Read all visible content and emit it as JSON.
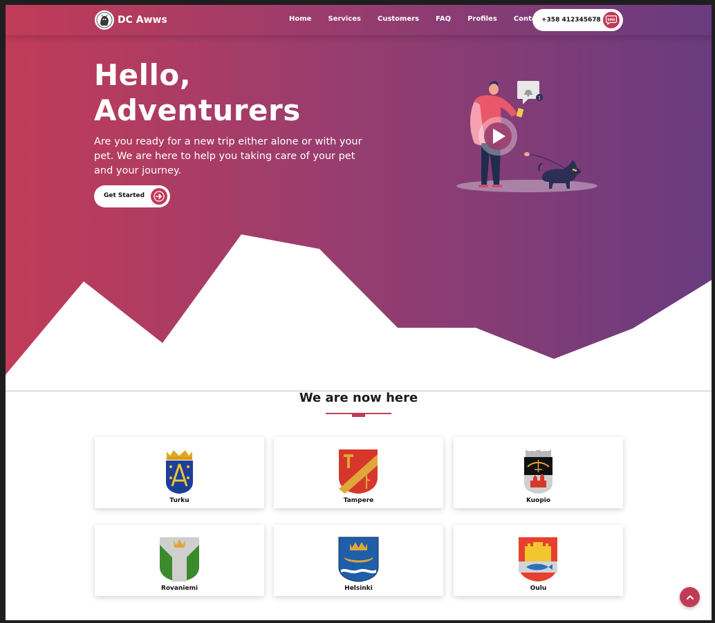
{
  "brand": {
    "name": "DC Awws"
  },
  "nav": {
    "links": [
      "Home",
      "Services",
      "Customers",
      "FAQ",
      "Profiles",
      "Contacts"
    ],
    "phone": "+358 412345678",
    "sms_icon": "sms-icon"
  },
  "hero": {
    "title": "Hello,\nAdventurers",
    "subtitle": "Are you ready for a new trip either alone or with your pet. We are here to help you taking care of your pet and your journey.",
    "cta_label": "Get Started"
  },
  "locations": {
    "title": "We are now here",
    "cities": [
      "Turku",
      "Tampere",
      "Kuopio",
      "Rovaniemi",
      "Helsinki",
      "Oulu"
    ]
  },
  "colors": {
    "accent": "#c13b57",
    "gradient_start": "#c13b57",
    "gradient_end": "#6a3b7f"
  }
}
